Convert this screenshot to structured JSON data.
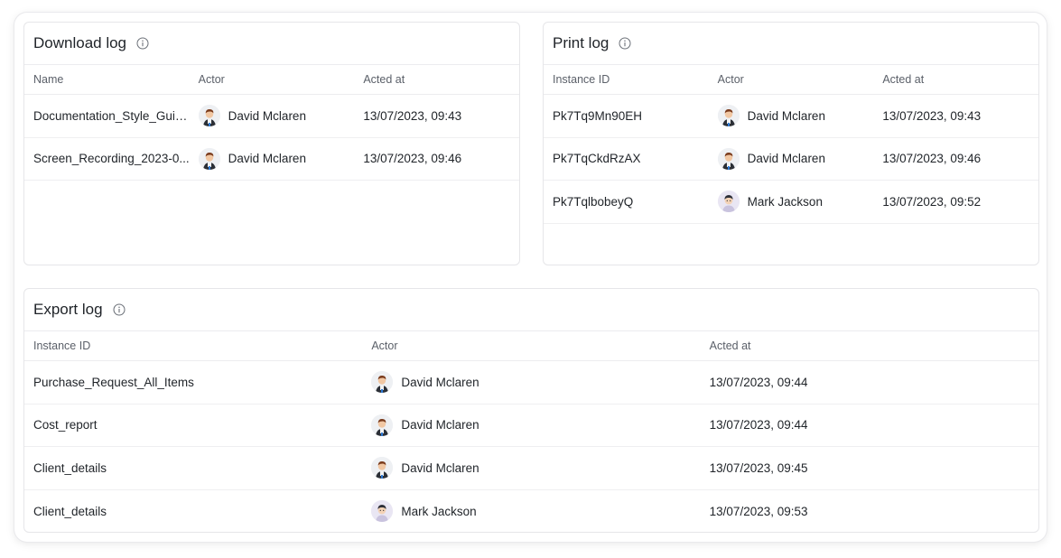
{
  "download_log": {
    "title": "Download log",
    "columns": [
      "Name",
      "Actor",
      "Acted at"
    ],
    "rows": [
      {
        "name": "Documentation_Style_Guid...",
        "actor": "David Mclaren",
        "avatar": "david",
        "acted_at": "13/07/2023, 09:43"
      },
      {
        "name": "Screen_Recording_2023-0...",
        "actor": "David Mclaren",
        "avatar": "david",
        "acted_at": "13/07/2023, 09:46"
      }
    ]
  },
  "print_log": {
    "title": "Print log",
    "columns": [
      "Instance ID",
      "Actor",
      "Acted at"
    ],
    "rows": [
      {
        "name": "Pk7Tq9Mn90EH",
        "actor": "David Mclaren",
        "avatar": "david",
        "acted_at": "13/07/2023, 09:43"
      },
      {
        "name": "Pk7TqCkdRzAX",
        "actor": "David Mclaren",
        "avatar": "david",
        "acted_at": "13/07/2023, 09:46"
      },
      {
        "name": "Pk7TqlbobeyQ",
        "actor": "Mark Jackson",
        "avatar": "mark",
        "acted_at": "13/07/2023, 09:52"
      }
    ]
  },
  "export_log": {
    "title": "Export log",
    "columns": [
      "Instance ID",
      "Actor",
      "Acted at"
    ],
    "rows": [
      {
        "name": "Purchase_Request_All_Items",
        "actor": "David Mclaren",
        "avatar": "david",
        "acted_at": "13/07/2023, 09:44"
      },
      {
        "name": "Cost_report",
        "actor": "David Mclaren",
        "avatar": "david",
        "acted_at": "13/07/2023, 09:44"
      },
      {
        "name": "Client_details",
        "actor": "David Mclaren",
        "avatar": "david",
        "acted_at": "13/07/2023, 09:45"
      },
      {
        "name": "Client_details",
        "actor": "Mark Jackson",
        "avatar": "mark",
        "acted_at": "13/07/2023, 09:53"
      }
    ]
  },
  "icons": {
    "info": "info-circle-icon",
    "avatar": "avatar-icon"
  },
  "colors": {
    "border": "#e6e6e9",
    "header_text": "#5b6069",
    "text": "#1f2328"
  }
}
